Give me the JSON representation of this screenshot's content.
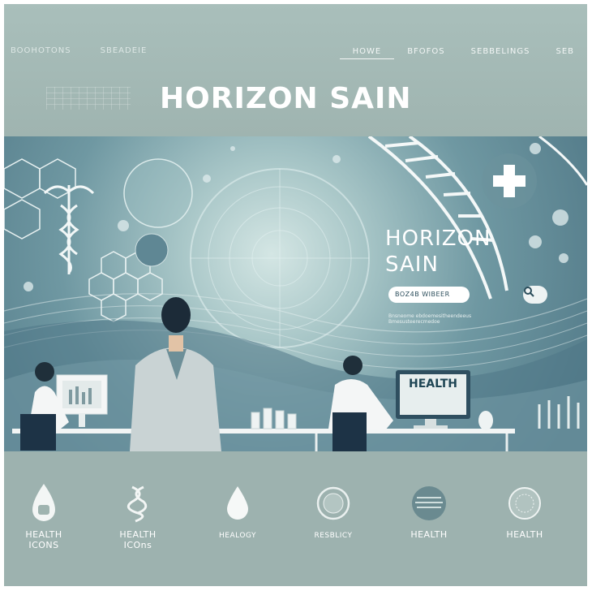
{
  "nav": {
    "left_items": [
      "BOOHOTONS",
      "SBEADEIE"
    ],
    "right_items": [
      {
        "label": "HOWE",
        "active": true
      },
      {
        "label": "BFOFOS",
        "active": false
      },
      {
        "label": "SEBBELINGS",
        "active": false
      },
      {
        "label": "SEB",
        "active": false
      }
    ]
  },
  "brand": {
    "title": "HORIZON SAIN"
  },
  "hero": {
    "title_line1": "HORIZON",
    "title_line2": "SAIN",
    "search_text": "BOZ4B WIBEER",
    "caption": "Bnsneome ebdoemesitheendeeus Bmesusteerecmedoe",
    "monitor_text": "HEALTH"
  },
  "footer_icons": [
    {
      "label_line1": "HEALTH",
      "label_line2": "ICONS",
      "icon": "drop-bottle-icon"
    },
    {
      "label_line1": "HEALTH",
      "label_line2": "ICOns",
      "icon": "dna-knot-icon"
    },
    {
      "label_line1": "HEALOGY",
      "label_line2": "",
      "icon": "drop-icon"
    },
    {
      "label_line1": "RESBLICY",
      "label_line2": "",
      "icon": "ring-icon"
    },
    {
      "label_line1": "HEALTH",
      "label_line2": "",
      "icon": "stripe-circle-icon"
    },
    {
      "label_line1": "HEALTH",
      "label_line2": "",
      "icon": "dotted-circle-icon"
    }
  ],
  "colors": {
    "background": "#9fb6b2",
    "hero_dark": "#557d8b",
    "accent_white": "#ffffff"
  }
}
